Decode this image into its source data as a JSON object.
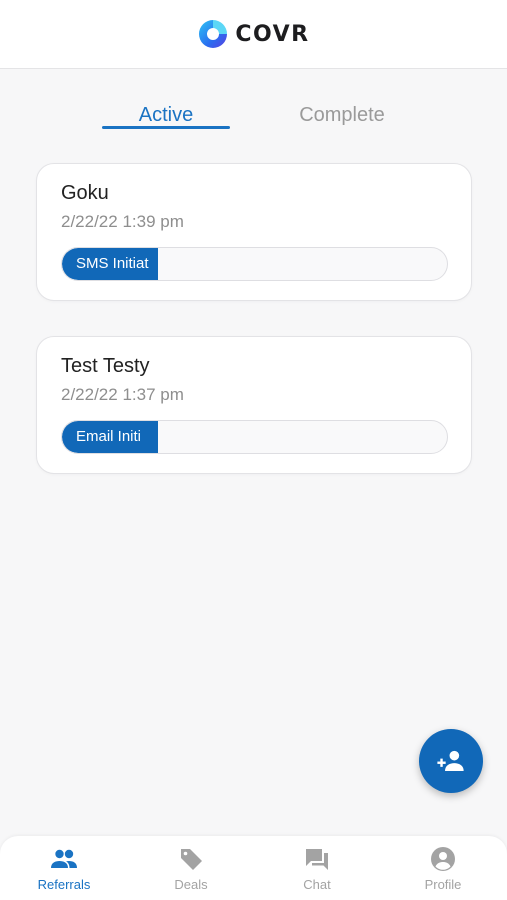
{
  "header": {
    "app_name": "COVR",
    "logo_icon": "covr-c-logo"
  },
  "tabs": [
    {
      "label": "Active",
      "selected": true
    },
    {
      "label": "Complete",
      "selected": false
    }
  ],
  "referrals": [
    {
      "name": "Goku",
      "datetime": "2/22/22 1:39 pm",
      "status_visible_text": "SMS Initiat",
      "progress_fraction": 0.25
    },
    {
      "name": "Test Testy",
      "datetime": "2/22/22 1:37 pm",
      "status_visible_text": "Email Initi",
      "progress_fraction": 0.25
    }
  ],
  "fab": {
    "icon": "add-person-icon"
  },
  "bottom_nav": [
    {
      "label": "Referrals",
      "icon": "people-icon",
      "active": true
    },
    {
      "label": "Deals",
      "icon": "tag-icon",
      "active": false
    },
    {
      "label": "Chat",
      "icon": "chat-icon",
      "active": false
    },
    {
      "label": "Profile",
      "icon": "account-circle-icon",
      "active": false
    }
  ],
  "colors": {
    "accent": "#1a73c3",
    "progress": "#1168b8",
    "inactive": "#a3a3a3"
  }
}
